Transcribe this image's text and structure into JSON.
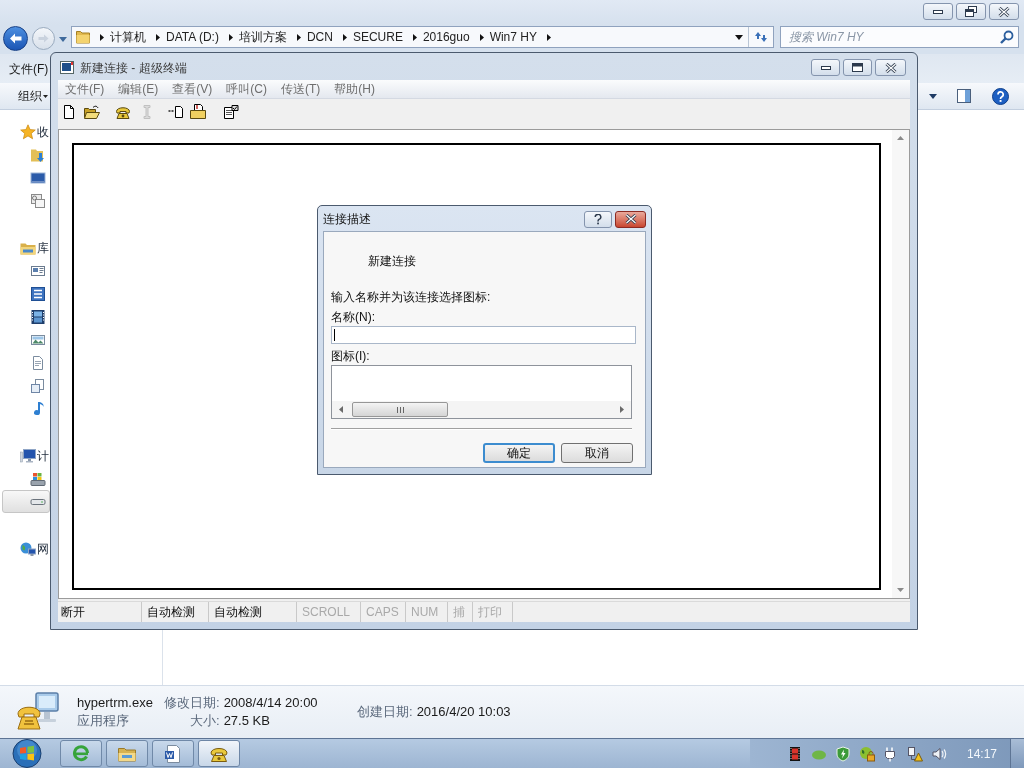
{
  "explorer": {
    "address_bar": {
      "path": [
        "计算机",
        "DATA (D:)",
        "培训方案",
        "DCN",
        "SECURE",
        "2016guo",
        "Win7 HY"
      ]
    },
    "search": {
      "placeholder": "搜索 Win7 HY"
    },
    "menu": [
      "文件(F)"
    ],
    "toolbar": {
      "organize": "组织"
    },
    "nav_pane": {
      "groups": [
        {
          "label": "收",
          "selected": false,
          "items": [
            {
              "selected": false
            },
            {
              "selected": false
            },
            {
              "selected": false
            }
          ]
        },
        {
          "label": "库",
          "selected": false,
          "items": [
            {
              "selected": false
            },
            {
              "selected": false
            },
            {
              "selected": false
            },
            {
              "selected": false
            },
            {
              "selected": false
            },
            {
              "selected": false
            },
            {
              "selected": false
            }
          ]
        },
        {
          "label": "计",
          "selected": false,
          "items": [
            {
              "selected": false
            },
            {
              "selected": true
            }
          ]
        },
        {
          "label": "网",
          "selected": false
        }
      ]
    },
    "details_pane": {
      "name": "hypertrm.exe",
      "type": "应用程序",
      "fields": [
        {
          "label": "修改日期:",
          "value": "2008/4/14 20:00"
        },
        {
          "label": "大小:",
          "value": "27.5 KB"
        },
        {
          "label": "创建日期:",
          "value": "2016/4/20 10:03"
        }
      ]
    }
  },
  "hyperterminal": {
    "title": "新建连接 - 超级终端",
    "menu": [
      "文件(F)",
      "编辑(E)",
      "查看(V)",
      "呼叫(C)",
      "传送(T)",
      "帮助(H)"
    ],
    "toolbar": [
      {
        "disabled": false
      },
      {
        "disabled": false
      },
      {
        "disabled": false
      },
      {
        "disabled": true
      },
      {
        "disabled": false
      },
      {
        "disabled": false
      },
      {
        "disabled": false
      }
    ],
    "status_bar": [
      {
        "text": "断开",
        "disabled": false
      },
      {
        "text": "自动检测",
        "disabled": false
      },
      {
        "text": "自动检测",
        "disabled": false
      },
      {
        "text": "SCROLL",
        "disabled": true
      },
      {
        "text": "CAPS",
        "disabled": true
      },
      {
        "text": "NUM",
        "disabled": true
      },
      {
        "text": "捕",
        "disabled": true
      },
      {
        "text": "打印",
        "disabled": true
      }
    ]
  },
  "dialog": {
    "title": "连接描述",
    "heading": "新建连接",
    "prompt": "输入名称并为该连接选择图标:",
    "name_field": {
      "label": "名称(N):",
      "focused": true
    },
    "icon_list": {
      "label": "图标(I):"
    },
    "buttons": [
      {
        "label": "确定",
        "default": true
      },
      {
        "label": "取消",
        "default": false
      }
    ]
  },
  "taskbar": {
    "apps": [
      {
        "selected": false
      },
      {
        "selected": false
      },
      {
        "selected": false
      },
      {
        "selected": true
      }
    ],
    "clock": "14:17"
  }
}
